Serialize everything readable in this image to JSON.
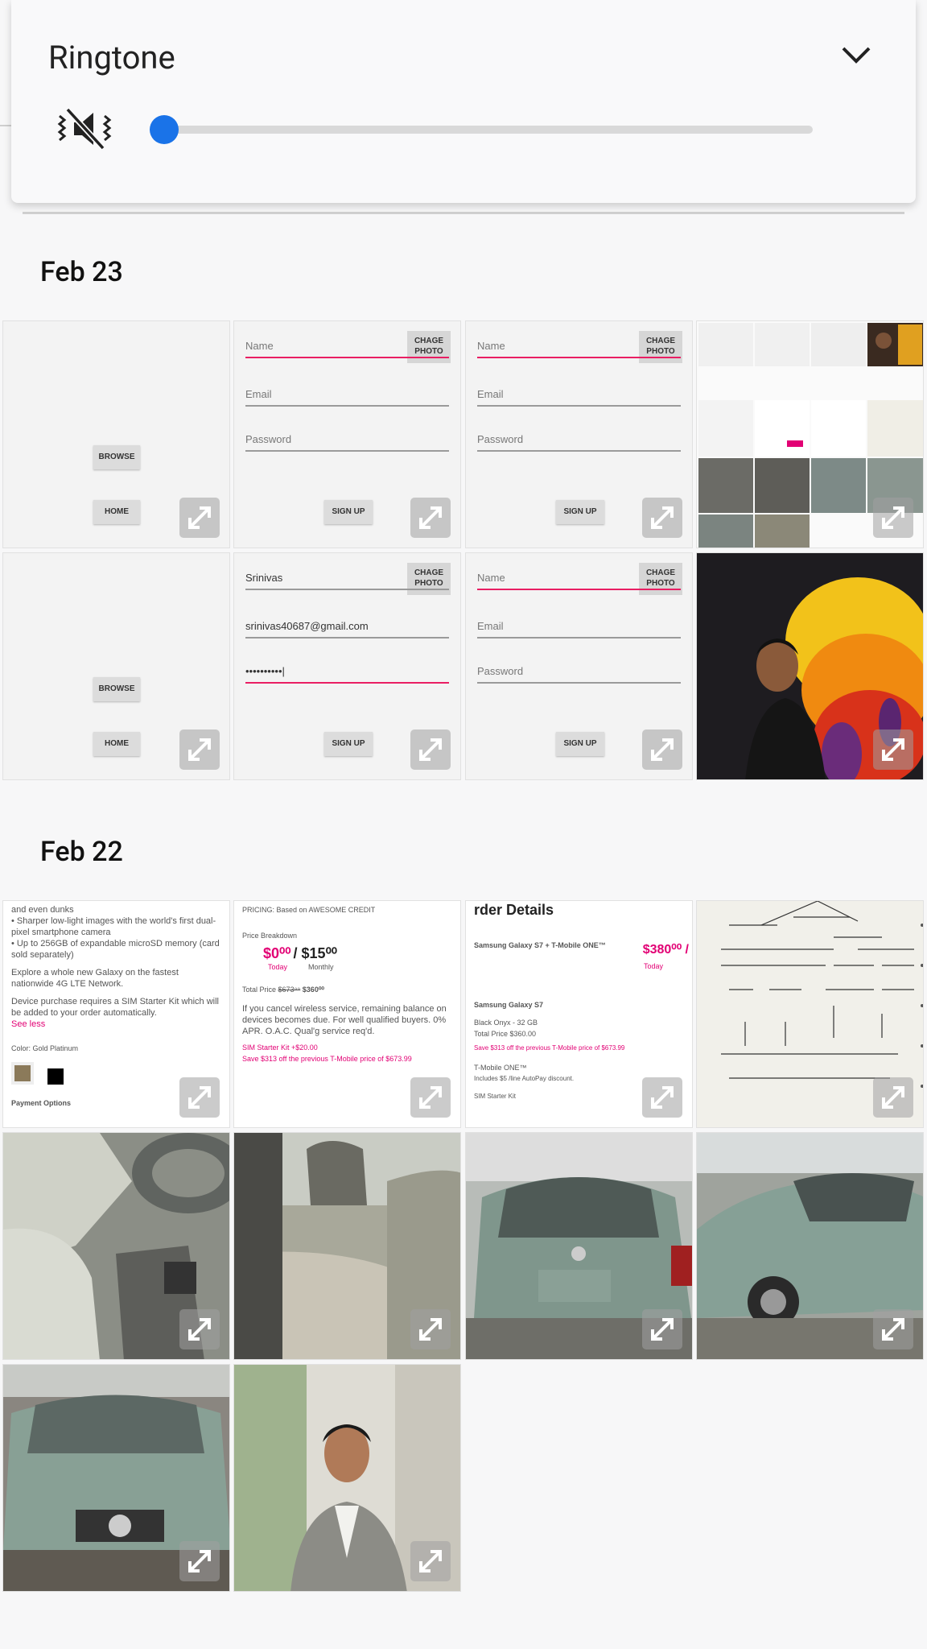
{
  "volume_panel": {
    "title": "Ringtone",
    "level": 0,
    "mute_icon": "vibrate-off-icon",
    "accent_color": "#1a73e8"
  },
  "sections": [
    {
      "date": "Feb 23"
    },
    {
      "date": "Feb 22"
    }
  ],
  "form_tiles": {
    "browse_label": "BROWSE",
    "home_label": "HOME",
    "change_photo_label": "CHAGE PHOTO",
    "name_placeholder": "Name",
    "email_placeholder": "Email",
    "password_placeholder": "Password",
    "signup_label": "SIGN UP",
    "filled_name": "Srinivas",
    "filled_email": "srinivas40687@gmail.com",
    "filled_password": "••••••••••|"
  },
  "doc_tiles": {
    "tile1": {
      "lines": [
        "and even dunks",
        "• Sharper low-light images with the world's first dual-pixel smartphone camera",
        "• Up to 256GB of expandable microSD memory (card sold separately)",
        "Explore a whole new Galaxy on the fastest nationwide 4G LTE Network.",
        "Device purchase requires a SIM Starter Kit which will be added to your order automatically."
      ],
      "see_less": "See less",
      "color_label": "Color: Gold Platinum",
      "payment_label": "Payment Options"
    },
    "tile2": {
      "pricing": "PRICING: Based on AWESOME CREDIT",
      "breakdown": "Price Breakdown",
      "today_price": "$0⁰⁰",
      "monthly_price": "$15⁰⁰",
      "today_label": "Today",
      "monthly_label": "Monthly",
      "total_label": "Total Price",
      "total_old": "$673⁹⁹",
      "total_new": "$360⁰⁰",
      "note": "If you cancel wireless service, remaining balance on devices becomes due. For well qualified buyers. 0% APR. O.A.C. Qual'g service req'd.",
      "sim_line": "SIM Starter Kit +$20.00",
      "save_line": "Save $313 off the previous T-Mobile price of $673.99"
    },
    "tile3": {
      "header": "rder Details",
      "product": "Samsung Galaxy S7 + T-Mobile ONE™",
      "price": "$380⁰⁰ /",
      "today_label": "Today",
      "sub_product": "Samsung Galaxy S7",
      "spec": "Black Onyx - 32 GB",
      "total": "Total Price $360.00",
      "save_line": "Save $313 off the previous T-Mobile price of $673.99",
      "plan": "T-Mobile ONE™",
      "plan_note": "Includes $5 /line AutoPay discount.",
      "sim": "SIM Starter Kit"
    }
  },
  "icons": {
    "expand": "expand-icon",
    "chevron": "chevron-down-icon"
  }
}
